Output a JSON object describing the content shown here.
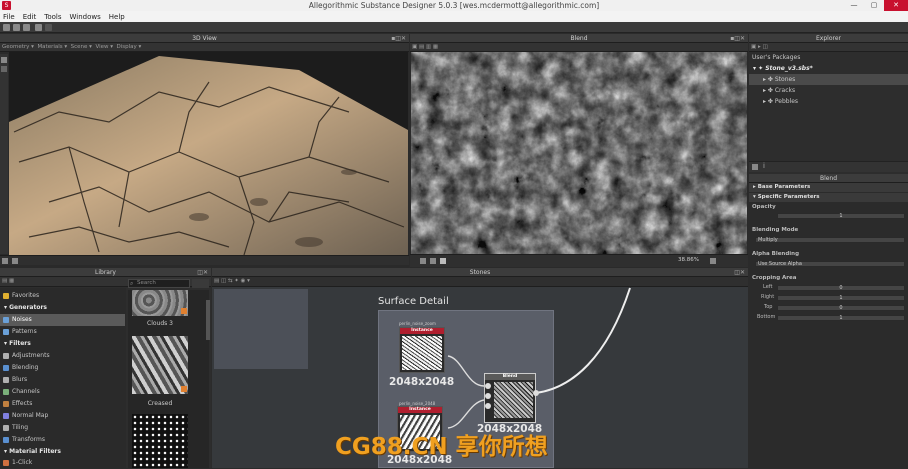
{
  "window": {
    "title": "Allegorithmic Substance Designer 5.0.3 [wes.mcdermott@allegorithmic.com]",
    "app_icon": "S",
    "minimize": "—",
    "maximize": "▢",
    "close": "✕"
  },
  "menu": [
    "File",
    "Edit",
    "Tools",
    "Windows",
    "Help"
  ],
  "panels": {
    "view3d": {
      "title": "3D View",
      "menu": [
        "Geometry ▾",
        "Materials ▾",
        "Scene ▾",
        "View ▾",
        "Display ▾"
      ]
    },
    "blend": {
      "title": "Blend",
      "zoom": "38.86%"
    },
    "explorer": {
      "title": "Explorer",
      "root": "User's Packages",
      "package": "Stone_v3.sbs*",
      "items": [
        "Stones",
        "Cracks",
        "Pebbles"
      ]
    },
    "parameters": {
      "title": "Blend",
      "sections": [
        "Base Parameters",
        "Specific Parameters"
      ],
      "opacity": {
        "label": "Opacity",
        "value": "1"
      },
      "blending_mode": {
        "label": "Blending Mode",
        "value": "Multiply"
      },
      "alpha_blending": {
        "label": "Alpha Blending",
        "value": "Use Source Alpha"
      },
      "cropping_area": {
        "label": "Cropping Area",
        "fields": [
          {
            "label": "Left",
            "value": "0"
          },
          {
            "label": "Right",
            "value": "1"
          },
          {
            "label": "Top",
            "value": "0"
          },
          {
            "label": "Bottom",
            "value": "1"
          }
        ]
      }
    },
    "library": {
      "title": "Library",
      "search_placeholder": "Search",
      "categories": [
        {
          "label": "Favorites",
          "type": "item",
          "color": "#e0b030"
        },
        {
          "label": "Generators",
          "type": "cat"
        },
        {
          "label": "Noises",
          "type": "item",
          "color": "#6aa0d8",
          "selected": true
        },
        {
          "label": "Patterns",
          "type": "item",
          "color": "#6aa0d8"
        },
        {
          "label": "Filters",
          "type": "cat"
        },
        {
          "label": "Adjustments",
          "type": "item",
          "color": "#b0b0b0"
        },
        {
          "label": "Blending",
          "type": "item",
          "color": "#5a90d0"
        },
        {
          "label": "Blurs",
          "type": "item",
          "color": "#b0b0b0"
        },
        {
          "label": "Channels",
          "type": "item",
          "color": "#7ab07a"
        },
        {
          "label": "Effects",
          "type": "item",
          "color": "#c08040"
        },
        {
          "label": "Normal Map",
          "type": "item",
          "color": "#8080e0"
        },
        {
          "label": "Tiling",
          "type": "item",
          "color": "#b0b0b0"
        },
        {
          "label": "Transforms",
          "type": "item",
          "color": "#5a90d0"
        },
        {
          "label": "Material Filters",
          "type": "cat"
        },
        {
          "label": "1-Click",
          "type": "item",
          "color": "#d07040"
        }
      ],
      "thumbnails": [
        "Clouds 3",
        "Creased"
      ]
    },
    "graph": {
      "title": "Stones",
      "frame_title": "Surface Detail",
      "nodes": [
        {
          "name": "Instance",
          "caption": "perlin_noise_zoom",
          "size": "2048x2048"
        },
        {
          "name": "Instance",
          "caption": "perlin_noise_2048",
          "size": "2048x2048"
        },
        {
          "name": "Blend",
          "size": "2048x2048"
        }
      ]
    }
  },
  "watermark": "CG88.CN 享你所想"
}
